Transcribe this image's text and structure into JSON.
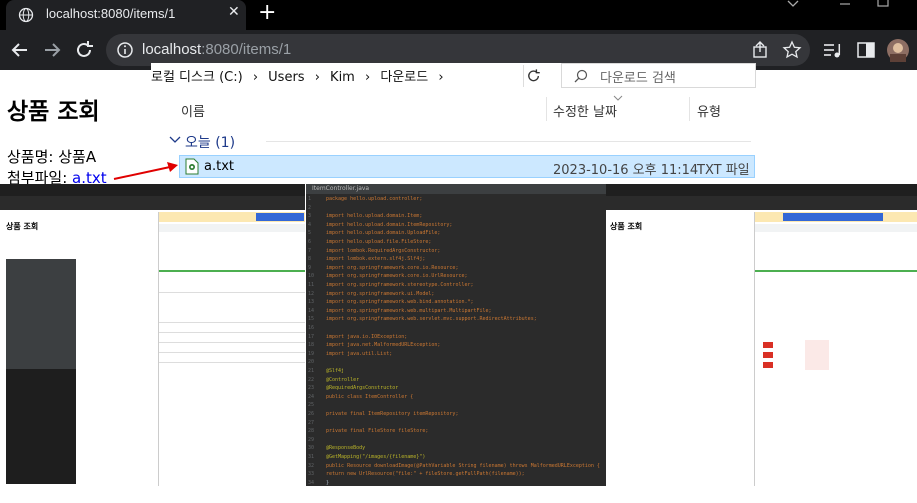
{
  "browser": {
    "tab_title": "localhost:8080/items/1",
    "tab_close": "✕",
    "new_tab": "+",
    "url_host": "localhost",
    "url_path": ":8080/items/1"
  },
  "page": {
    "heading": "상품 조회",
    "product_label": "상품명: 상품A",
    "attach_label": "첨부파일: ",
    "attach_link": "a.txt"
  },
  "explorer": {
    "breadcrumbs": [
      "로컬 디스크 (C:)",
      "›",
      "Users",
      "›",
      "Kim",
      "›",
      "다운로드",
      "›"
    ],
    "search_placeholder": "다운로드 검색",
    "columns": {
      "name": "이름",
      "modified": "수정한 날짜",
      "type": "유형"
    },
    "group_label": "오늘 (1)",
    "file": {
      "name": "a.txt",
      "date": "2023-10-16 오후 11:14",
      "type": "TXT 파일"
    }
  },
  "thumbnails": {
    "left_heading": "상품 조회",
    "right_heading": "상품 조회",
    "ide_tab": "ItemController.java",
    "code_lines": [
      "package hello.upload.controller;",
      "",
      "import hello.upload.domain.Item;",
      "import hello.upload.domain.ItemRepository;",
      "import hello.upload.domain.UploadFile;",
      "import hello.upload.file.FileStore;",
      "import lombok.RequiredArgsConstructor;",
      "import lombok.extern.slf4j.Slf4j;",
      "import org.springframework.core.io.Resource;",
      "import org.springframework.core.io.UrlResource;",
      "import org.springframework.stereotype.Controller;",
      "import org.springframework.ui.Model;",
      "import org.springframework.web.bind.annotation.*;",
      "import org.springframework.web.multipart.MultipartFile;",
      "import org.springframework.web.servlet.mvc.support.RedirectAttributes;",
      "",
      "import java.io.IOException;",
      "import java.net.MalformedURLException;",
      "import java.util.List;",
      "",
      "@Slf4j",
      "@Controller",
      "@RequiredArgsConstructor",
      "public class ItemController {",
      "",
      "    private final ItemRepository itemRepository;",
      "",
      "    private final FileStore fileStore;",
      "",
      "    @ResponseBody",
      "    @GetMapping(\"/images/{filename}\")",
      "    public Resource downloadImage(@PathVariable String filename) throws MalformedURLException {",
      "        return new UrlResource(\"file:\" + fileStore.getFullPath(filename));",
      "    }"
    ]
  },
  "colors": {
    "chrome_dark": "#202124",
    "selection": "#cce8ff",
    "link": "#0000ee",
    "arrow": "#e00000"
  }
}
